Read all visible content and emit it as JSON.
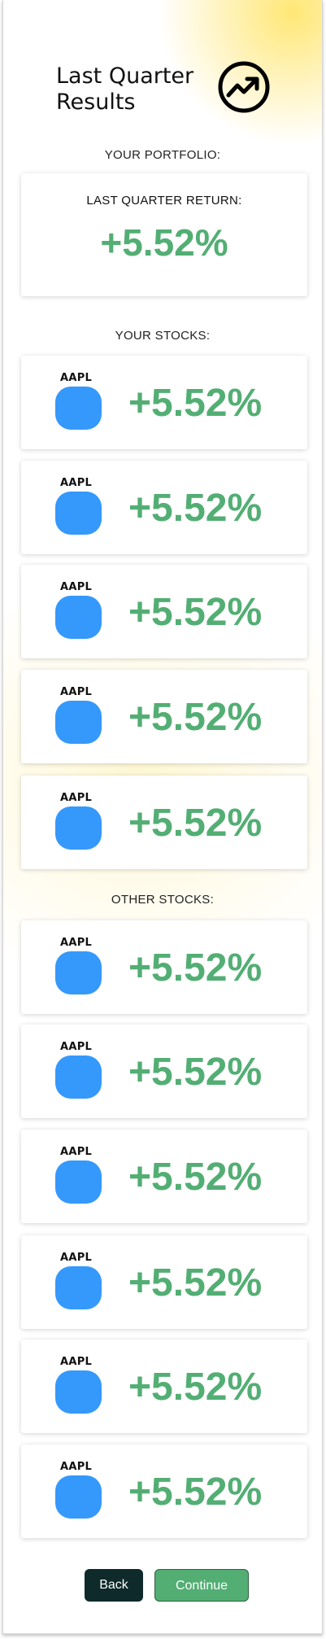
{
  "header": {
    "title": "Last Quarter Results",
    "icon": "trending-up-icon"
  },
  "portfolio": {
    "section_label": "YOUR PORTFOLIO:",
    "caption": "LAST QUARTER RETURN:",
    "value": "+5.52%"
  },
  "your_stocks": {
    "section_label": "YOUR STOCKS:",
    "items": [
      {
        "ticker": "AAPL",
        "change": "+5.52%"
      },
      {
        "ticker": "AAPL",
        "change": "+5.52%"
      },
      {
        "ticker": "AAPL",
        "change": "+5.52%"
      },
      {
        "ticker": "AAPL",
        "change": "+5.52%"
      },
      {
        "ticker": "AAPL",
        "change": "+5.52%"
      }
    ]
  },
  "other_stocks": {
    "section_label": "OTHER STOCKS:",
    "items": [
      {
        "ticker": "AAPL",
        "change": "+5.52%"
      },
      {
        "ticker": "AAPL",
        "change": "+5.52%"
      },
      {
        "ticker": "AAPL",
        "change": "+5.52%"
      },
      {
        "ticker": "AAPL",
        "change": "+5.52%"
      },
      {
        "ticker": "AAPL",
        "change": "+5.52%"
      },
      {
        "ticker": "AAPL",
        "change": "+5.52%"
      }
    ]
  },
  "actions": {
    "back_label": "Back",
    "continue_label": "Continue"
  },
  "colors": {
    "positive": "#53ae74",
    "logo_placeholder": "#3598fb",
    "back_button": "#0f2a2b",
    "continue_button": "#53ae74",
    "accent_glow": "#ffe66e"
  }
}
